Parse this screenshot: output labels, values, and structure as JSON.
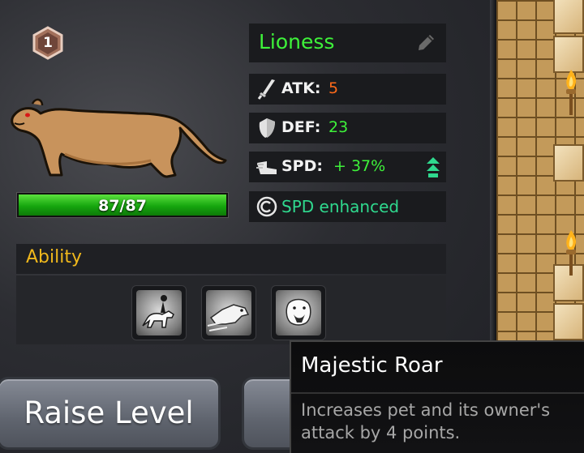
{
  "pet": {
    "level": "1",
    "name": "Lioness",
    "hp_text": "87/87",
    "hp_fraction": 1.0
  },
  "stats": {
    "atk_label": "ATK:",
    "atk_value": "5",
    "def_label": "DEF:",
    "def_value": "23",
    "spd_label": "SPD:",
    "spd_value": "+ 37%",
    "enhancement": "SPD enhanced"
  },
  "ability": {
    "header": "Ability",
    "slots": [
      "mounted-rider-icon",
      "charging-wolf-icon",
      "roaring-lion-icon"
    ]
  },
  "buttons": {
    "raise_level": "Raise Level",
    "second": ""
  },
  "tooltip": {
    "title": "Majestic Roar",
    "description": "Increases pet and its owner's attack by 4 points."
  },
  "colors": {
    "name": "#3ef23a",
    "atk": "#ff6a1a",
    "def": "#3ef23a",
    "spd": "#3ef23a",
    "enhanced": "#2fd98e",
    "ability_header": "#f0b81c",
    "hp_bar": "#3fcf2a"
  }
}
